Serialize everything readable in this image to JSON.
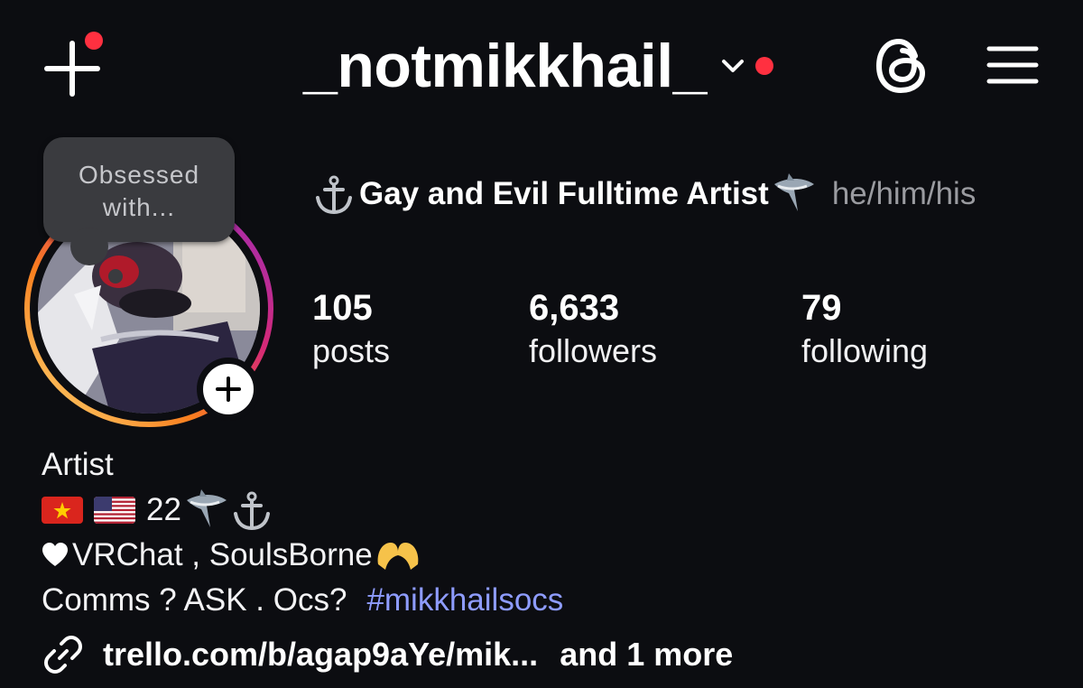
{
  "header": {
    "username": "_notmikkhail_",
    "icons": {
      "new_post": "plus-icon",
      "account_switch": "chevron-down-icon",
      "threads": "threads-icon",
      "menu": "hamburger-menu-icon"
    },
    "notification_color": "#ff3040"
  },
  "note": {
    "text_line1": "Obsessed",
    "text_line2": "with..."
  },
  "profile": {
    "headline_text": "Gay and Evil Fulltime Artist",
    "pronouns": "he/him/his",
    "stats": [
      {
        "value": "105",
        "label": "posts"
      },
      {
        "value": "6,633",
        "label": "followers"
      },
      {
        "value": "79",
        "label": "following"
      }
    ]
  },
  "bio": {
    "category": "Artist",
    "line1_age": "22",
    "line2_text": "VRChat , SoulsBorne",
    "line3_text": "Comms ? ASK . Ocs?",
    "hashtag": "#mikkhailsocs",
    "hashtag_color": "#8e9cff"
  },
  "links": {
    "url": "trello.com/b/agap9aYe/mik...",
    "more": "and 1 more"
  }
}
